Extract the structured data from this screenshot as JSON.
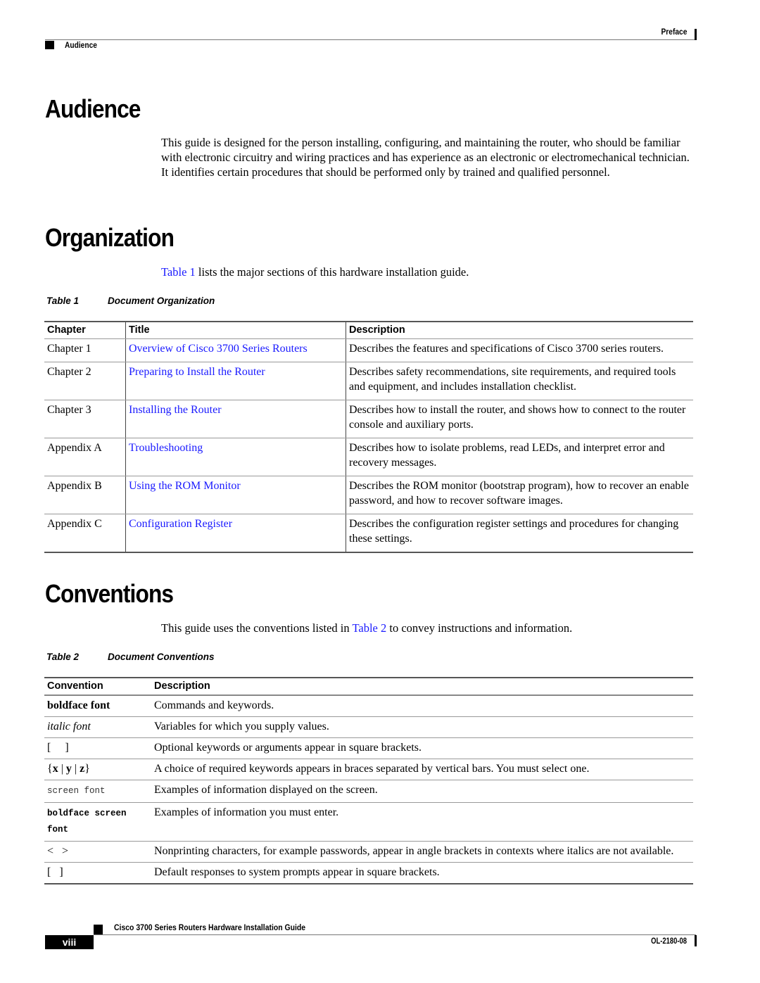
{
  "header": {
    "section": "Preface",
    "topic": "Audience"
  },
  "audience": {
    "heading": "Audience",
    "paragraph": "This guide is designed for the person installing, configuring, and maintaining the router, who should be familiar with electronic circuitry and wiring practices and has experience as an electronic or electromechanical technician. It identifies certain procedures that should be performed only by trained and qualified personnel."
  },
  "organization": {
    "heading": "Organization",
    "intro_link": "Table 1",
    "intro_rest": " lists the major sections of this hardware installation guide.",
    "table_caption_num": "Table 1",
    "table_caption_title": "Document Organization",
    "columns": [
      "Chapter",
      "Title",
      "Description"
    ],
    "rows": [
      {
        "chapter": "Chapter 1",
        "title": "Overview of Cisco 3700 Series Routers",
        "description": "Describes the features and specifications of Cisco 3700 series routers."
      },
      {
        "chapter": "Chapter 2",
        "title": "Preparing to Install the Router",
        "description": "Describes safety recommendations, site requirements, and required tools and equipment, and includes installation checklist."
      },
      {
        "chapter": "Chapter 3",
        "title": "Installing the Router",
        "description": "Describes how to install the router, and shows how to connect to the router console and auxiliary ports."
      },
      {
        "chapter": "Appendix A",
        "title": "Troubleshooting",
        "description": "Describes how to isolate problems, read LEDs, and interpret error and recovery messages."
      },
      {
        "chapter": "Appendix B",
        "title": "Using the ROM Monitor",
        "description": "Describes the ROM monitor (bootstrap program), how to recover an enable password, and how to recover software images."
      },
      {
        "chapter": "Appendix C",
        "title": "Configuration Register",
        "description": "Describes the configuration register settings and procedures for changing these settings."
      }
    ]
  },
  "conventions": {
    "heading": "Conventions",
    "intro_before": "This guide uses the conventions listed in ",
    "intro_link": "Table 2",
    "intro_after": " to convey instructions and information.",
    "table_caption_num": "Table 2",
    "table_caption_title": "Document Conventions",
    "columns": [
      "Convention",
      "Description"
    ],
    "rows": [
      {
        "convention": "boldface font",
        "style": "bold",
        "description": "Commands and keywords."
      },
      {
        "convention": "italic font",
        "style": "italic",
        "description": "Variables for which you supply values."
      },
      {
        "convention": "[     ]",
        "style": "plain",
        "description": "Optional keywords or arguments appear in square brackets."
      },
      {
        "convention": "{x | y | z}",
        "style": "braces",
        "description": "A choice of required keywords appears in braces separated by vertical bars. You must select one."
      },
      {
        "convention": "screen font",
        "style": "mono",
        "description": "Examples of information displayed on the screen."
      },
      {
        "convention": "boldface screen font",
        "style": "mono-bold",
        "description": "Examples of information you must enter."
      },
      {
        "convention": "<   >",
        "style": "plain",
        "description": "Nonprinting characters, for example passwords, appear in angle brackets in contexts where italics are not available."
      },
      {
        "convention": "[   ]",
        "style": "plain",
        "description": "Default responses to system prompts appear in square brackets."
      }
    ]
  },
  "footer": {
    "guide_title": "Cisco 3700 Series Routers Hardware Installation Guide",
    "page_number": "viii",
    "doc_number": "OL-2180-08"
  },
  "colors": {
    "link": "#1a1aff",
    "text": "#000000"
  }
}
